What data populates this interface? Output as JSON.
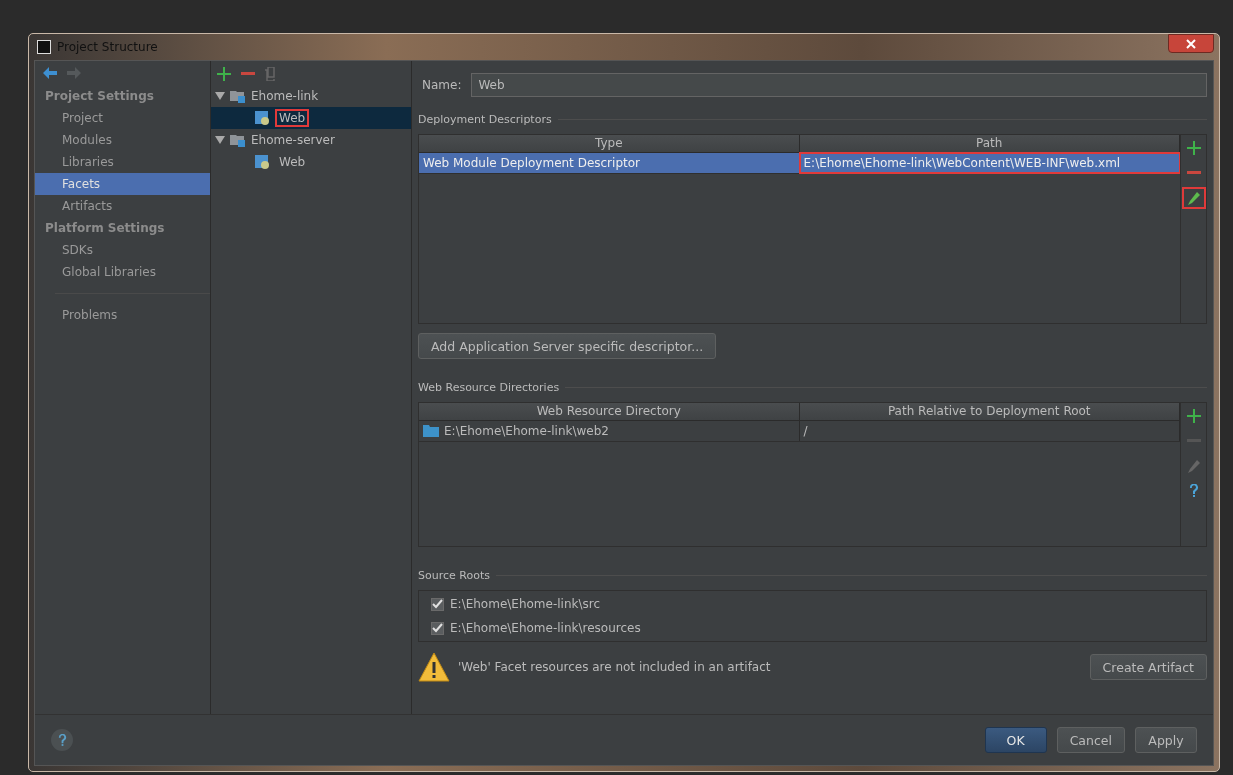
{
  "window": {
    "title": "Project Structure"
  },
  "sidebar": {
    "sections": [
      {
        "heading": "Project Settings",
        "items": [
          {
            "label": "Project",
            "selected": false
          },
          {
            "label": "Modules",
            "selected": false
          },
          {
            "label": "Libraries",
            "selected": false
          },
          {
            "label": "Facets",
            "selected": true
          },
          {
            "label": "Artifacts",
            "selected": false
          }
        ]
      },
      {
        "heading": "Platform Settings",
        "items": [
          {
            "label": "SDKs",
            "selected": false
          },
          {
            "label": "Global Libraries",
            "selected": false
          }
        ]
      }
    ],
    "footer_items": [
      {
        "label": "Problems",
        "selected": false
      }
    ]
  },
  "tree": [
    {
      "label": "Ehome-link",
      "expanded": true,
      "children": [
        {
          "label": "Web",
          "selected": true,
          "highlighted": true
        }
      ]
    },
    {
      "label": "Ehome-server",
      "expanded": true,
      "children": [
        {
          "label": "Web",
          "selected": false,
          "highlighted": false
        }
      ]
    }
  ],
  "name_field": {
    "label": "Name:",
    "value": "Web"
  },
  "deployment_descriptors": {
    "title": "Deployment Descriptors",
    "columns": [
      "Type",
      "Path"
    ],
    "rows": [
      {
        "type": "Web Module Deployment Descriptor",
        "path": "E:\\Ehome\\Ehome-link\\WebContent\\WEB-INF\\web.xml",
        "selected": true,
        "path_highlighted": true
      }
    ],
    "tools": [
      {
        "kind": "add",
        "disabled": false,
        "highlighted": false
      },
      {
        "kind": "remove",
        "disabled": false,
        "highlighted": false
      },
      {
        "kind": "edit",
        "disabled": false,
        "highlighted": true
      }
    ],
    "button": "Add Application Server specific descriptor..."
  },
  "web_resource_directories": {
    "title": "Web Resource Directories",
    "columns": [
      "Web Resource Directory",
      "Path Relative to Deployment Root"
    ],
    "rows": [
      {
        "directory": "E:\\Ehome\\Ehome-link\\web2",
        "relative_path": "/",
        "selected": false
      }
    ],
    "tools": [
      {
        "kind": "add",
        "disabled": false,
        "highlighted": false
      },
      {
        "kind": "remove",
        "disabled": true,
        "highlighted": false
      },
      {
        "kind": "edit",
        "disabled": true,
        "highlighted": false
      },
      {
        "kind": "help",
        "disabled": false,
        "highlighted": false
      }
    ]
  },
  "source_roots": {
    "title": "Source Roots",
    "items": [
      {
        "path": "E:\\Ehome\\Ehome-link\\src",
        "checked": true
      },
      {
        "path": "E:\\Ehome\\Ehome-link\\resources",
        "checked": true
      }
    ]
  },
  "warning": {
    "text": "'Web' Facet resources are not included in an artifact",
    "button": "Create Artifact"
  },
  "buttons": [
    {
      "label": "OK",
      "kind": "primary"
    },
    {
      "label": "Cancel",
      "kind": "normal"
    },
    {
      "label": "Apply",
      "kind": "normal"
    }
  ]
}
